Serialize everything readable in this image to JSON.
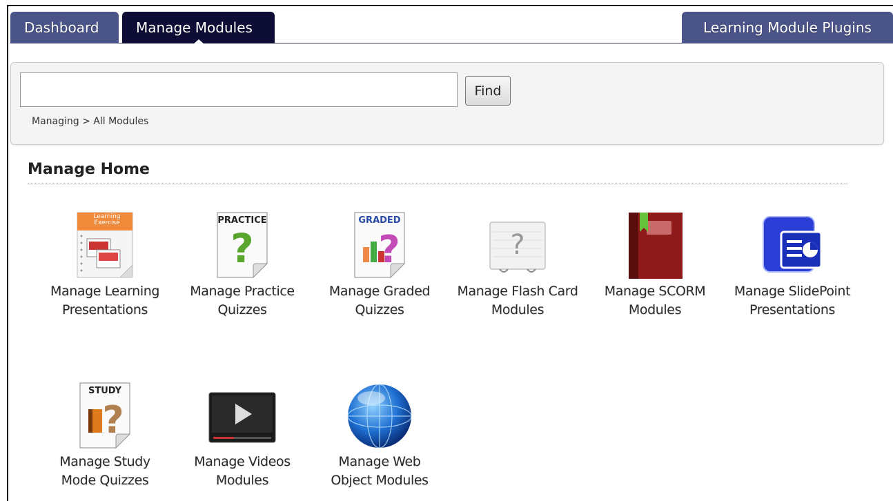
{
  "tabs": {
    "dashboard": "Dashboard",
    "manage_modules": "Manage Modules",
    "plugins": "Learning Module Plugins"
  },
  "search": {
    "value": "",
    "placeholder": "",
    "find_label": "Find"
  },
  "breadcrumb": "Managing > All Modules",
  "section": {
    "title": "Manage Home"
  },
  "modules": [
    {
      "line1": "Manage Learning",
      "line2": "Presentations",
      "icon": "learning-exercise-icon",
      "icon_text": "Learning Exercise"
    },
    {
      "line1": "Manage Practice",
      "line2": "Quizzes",
      "icon": "practice-quiz-icon",
      "icon_text": "PRACTICE"
    },
    {
      "line1": "Manage Graded",
      "line2": "Quizzes",
      "icon": "graded-quiz-icon",
      "icon_text": "GRADED"
    },
    {
      "line1": "Manage Flash Card",
      "line2": "Modules",
      "icon": "flash-card-icon"
    },
    {
      "line1": "Manage SCORM",
      "line2": "Modules",
      "icon": "scorm-book-icon"
    },
    {
      "line1": "Manage SlidePoint",
      "line2": "Presentations",
      "icon": "slidepoint-icon"
    },
    {
      "line1": "Manage Study",
      "line2": "Mode Quizzes",
      "icon": "study-quiz-icon",
      "icon_text": "STUDY"
    },
    {
      "line1": "Manage Videos",
      "line2": "Modules",
      "icon": "video-player-icon"
    },
    {
      "line1": "Manage Web",
      "line2": "Object Modules",
      "icon": "globe-icon"
    }
  ],
  "colors": {
    "tab_active": "#0e0d36",
    "tab_inactive": "#4a5488",
    "panel_bg": "#f4f4f4"
  }
}
